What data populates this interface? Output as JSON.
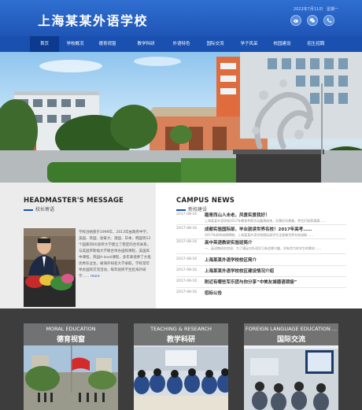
{
  "header": {
    "logo": "上海某某外语学校",
    "date_text": "2022年7月11日",
    "extra_text": "星期一",
    "icons": [
      "weibo-icon",
      "wechat-icon",
      "phone-icon"
    ]
  },
  "nav": {
    "items": [
      "首页",
      "学校概况",
      "德育视窗",
      "教学科研",
      "外语特色",
      "国际交流",
      "学子风采",
      "校园建设",
      "招生招聘"
    ],
    "active_index": 0
  },
  "headmaster": {
    "title": "HEADMASTER'S MESSAGE",
    "subtitle": "校长寄语",
    "text": "学校创始部于1999年，2013年由政府中学，美国、英国、加拿大、澳国、日本、韩国等12个国家的60多所大学建立了稳定的合作关系，与美国罗斯福大学联合举办国际课程，美国高中课程，英国A-level课程，多年来培养了大批优秀毕业生，被海外知名大学录取，学校常年举办国际交流活动，每年组织学生赴海外研学……",
    "more": "more"
  },
  "news": {
    "title": "CAMPUS NEWS",
    "subtitle": "新校建设",
    "items": [
      {
        "date": "2017-08-16",
        "title": "踏青西山人未老，风景实景我好！",
        "desc": "上海某某外语学校2017年教育考察活动圆满结束，风景好风景美，师生们收获满满……"
      },
      {
        "date": "2017-08-16",
        "title": "成都实验国际部，毕业就读世界名校！2017年高考……",
        "desc": "2017年高考成绩揭晓，上海某某外语学校国际部学生全部被世界名校录取……"
      },
      {
        "date": "2017-08-16",
        "title": "高中英语教研实验班简介",
        "desc": "一、英语教研实验班：为了满足对外语学习有浓厚兴趣、学有余力的学生的需求……"
      },
      {
        "date": "2017-08-16",
        "title": "上海某某外语学校校区简介",
        "desc": ""
      },
      {
        "date": "2017-08-16",
        "title": "上海某某外语学校校区建设情况介绍",
        "desc": ""
      },
      {
        "date": "2017-08-16",
        "title": "附近有哪些军乐团与你分享“中美友城德语颂接”",
        "desc": ""
      },
      {
        "date": "2017-08-16",
        "title": "招标公告",
        "desc": ""
      }
    ]
  },
  "cards": [
    {
      "en": "MORAL EDUCATION",
      "cn": "德育视窗"
    },
    {
      "en": "TEACHING & RESEARCH",
      "cn": "教学科研"
    },
    {
      "en": "FOREIGN LANGUAGE EDUCATION ...",
      "cn": "国际交流"
    }
  ],
  "colors": {
    "brand": "#1f55b6",
    "nav": "#1a50b0",
    "active": "#0c3a8f",
    "band": "#3d3d3d"
  }
}
